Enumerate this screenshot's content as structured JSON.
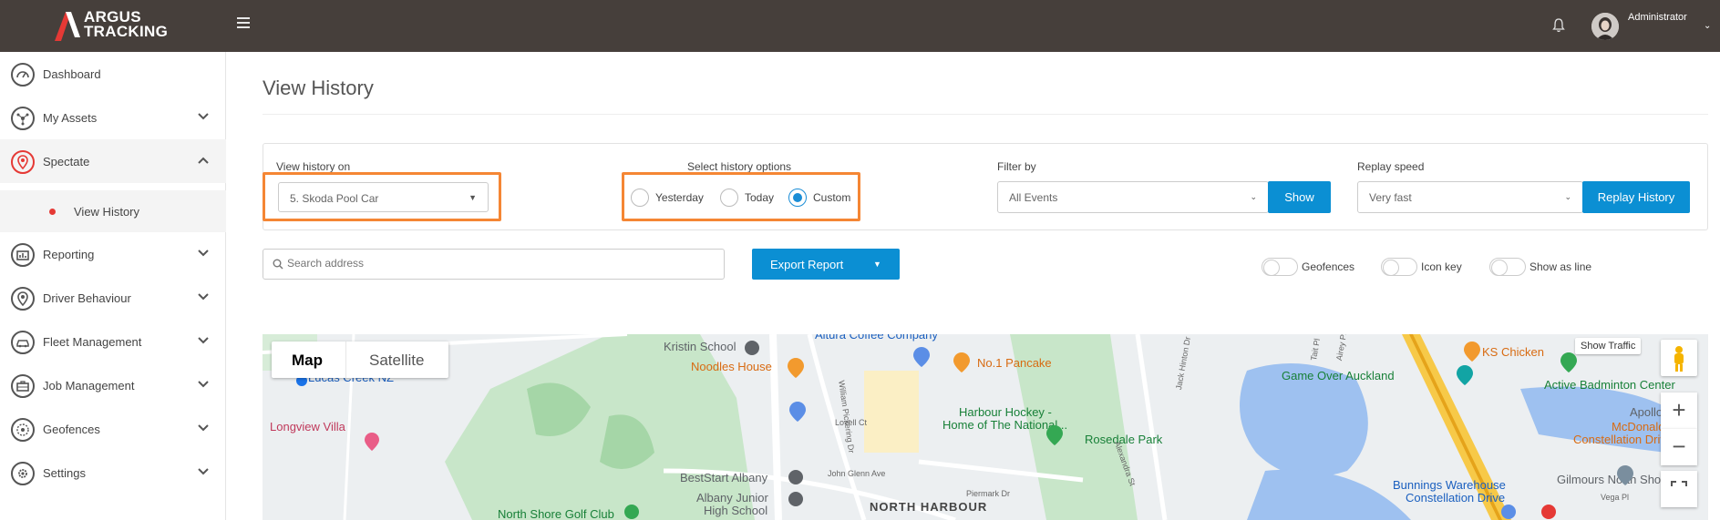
{
  "brand": {
    "line1": "ARGUS",
    "line2": "TRACKING"
  },
  "header": {
    "user_name": "Administrator"
  },
  "sidebar": {
    "items": [
      {
        "label": "Dashboard"
      },
      {
        "label": "My Assets"
      },
      {
        "label": "Spectate"
      },
      {
        "label": "Reporting"
      },
      {
        "label": "Driver Behaviour"
      },
      {
        "label": "Fleet Management"
      },
      {
        "label": "Job Management"
      },
      {
        "label": "Geofences"
      },
      {
        "label": "Settings"
      }
    ],
    "sub_item": {
      "label": "View History"
    }
  },
  "page": {
    "title": "View History"
  },
  "filters": {
    "view_history_label": "View history on",
    "vehicle_value": "5. Skoda Pool Car",
    "history_options_label": "Select history options",
    "radio_options": [
      "Yesterday",
      "Today",
      "Custom"
    ],
    "selected_option": "Custom",
    "filter_by_label": "Filter by",
    "filter_value": "All Events",
    "show_button": "Show",
    "replay_speed_label": "Replay speed",
    "replay_speed_value": "Very fast",
    "replay_button": "Replay History"
  },
  "toolbar": {
    "search_placeholder": "Search address",
    "export_label": "Export Report",
    "toggles": [
      "Geofences",
      "Icon key",
      "Show as line"
    ]
  },
  "map": {
    "type_map": "Map",
    "type_satellite": "Satellite",
    "show_traffic": "Show Traffic",
    "zoom_in": "+",
    "zoom_out": "−",
    "places": [
      "Lucas Creek NZ",
      "Longview Villa",
      "Kristin School",
      "Noodles House",
      "Altura Coffee Company",
      "No.1 Pancake",
      "Harbour Hockey -",
      "Home of The National...",
      "Rosedale Park",
      "Game Over Auckland",
      "KS Chicken",
      "Active Badminton Center",
      "BestStart Albany",
      "Albany Junior",
      "High School",
      "North Shore Golf Club",
      "NORTH HARBOUR",
      "Bunnings Warehouse",
      "Constellation Drive",
      "Gilmours North Shore",
      "McDonald's",
      "Constellation Drive",
      "Vega Pl",
      "Apollo"
    ],
    "roads": [
      "William Pickering Dr",
      "Lovell Ct",
      "John Glenn Ave",
      "Piermark Dr",
      "Jack Hinton Dr",
      "Alexandra St",
      "Tait Pl",
      "Airey Pl"
    ]
  }
}
